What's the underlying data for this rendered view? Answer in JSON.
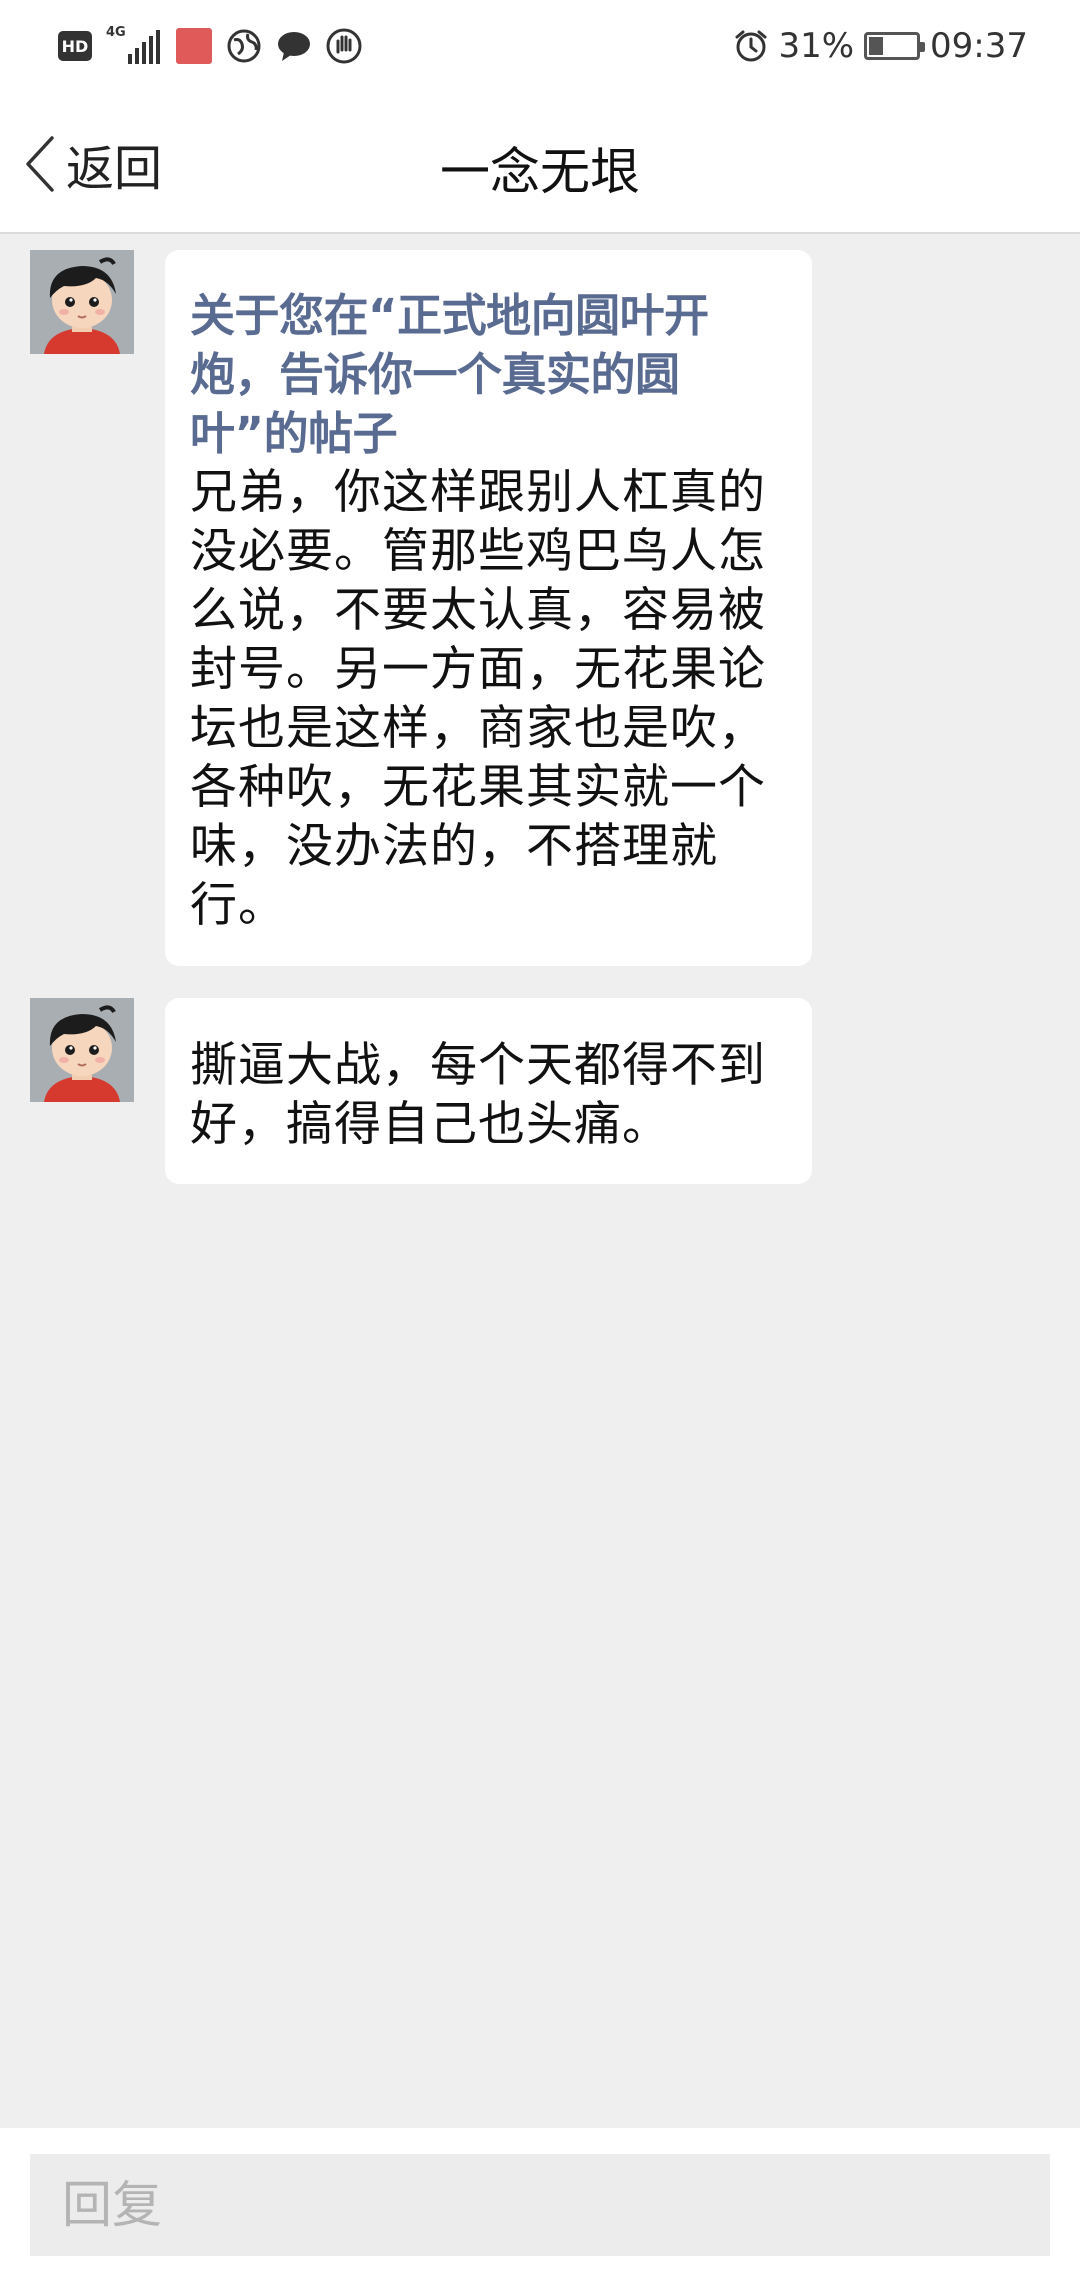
{
  "status_bar": {
    "hd_label": "HD",
    "network_label": "4G",
    "battery_percent": "31%",
    "time": "09:37",
    "icons": [
      "hd-icon",
      "signal-icon",
      "app-notification-icon",
      "browser-icon",
      "chat-icon",
      "hand-icon",
      "alarm-icon",
      "battery-icon"
    ]
  },
  "nav": {
    "back_label": "返回",
    "title": "一念无垠"
  },
  "messages": [
    {
      "title": "关于您在“正式地向圆叶开炮，告诉你一个真实的圆叶”的帖子",
      "body": "兄弟，你这样跟别人杠真的没必要。管那些鸡巴鸟人怎么说，不要太认真，容易被封号。另一方面，无花果论坛也是这样，商家也是吹，各种吹，无花果其实就一个味，没办法的，不搭理就行。"
    },
    {
      "body": "撕逼大战，每个天都得不到好，搞得自己也头痛。"
    }
  ],
  "reply": {
    "placeholder": "回复"
  }
}
